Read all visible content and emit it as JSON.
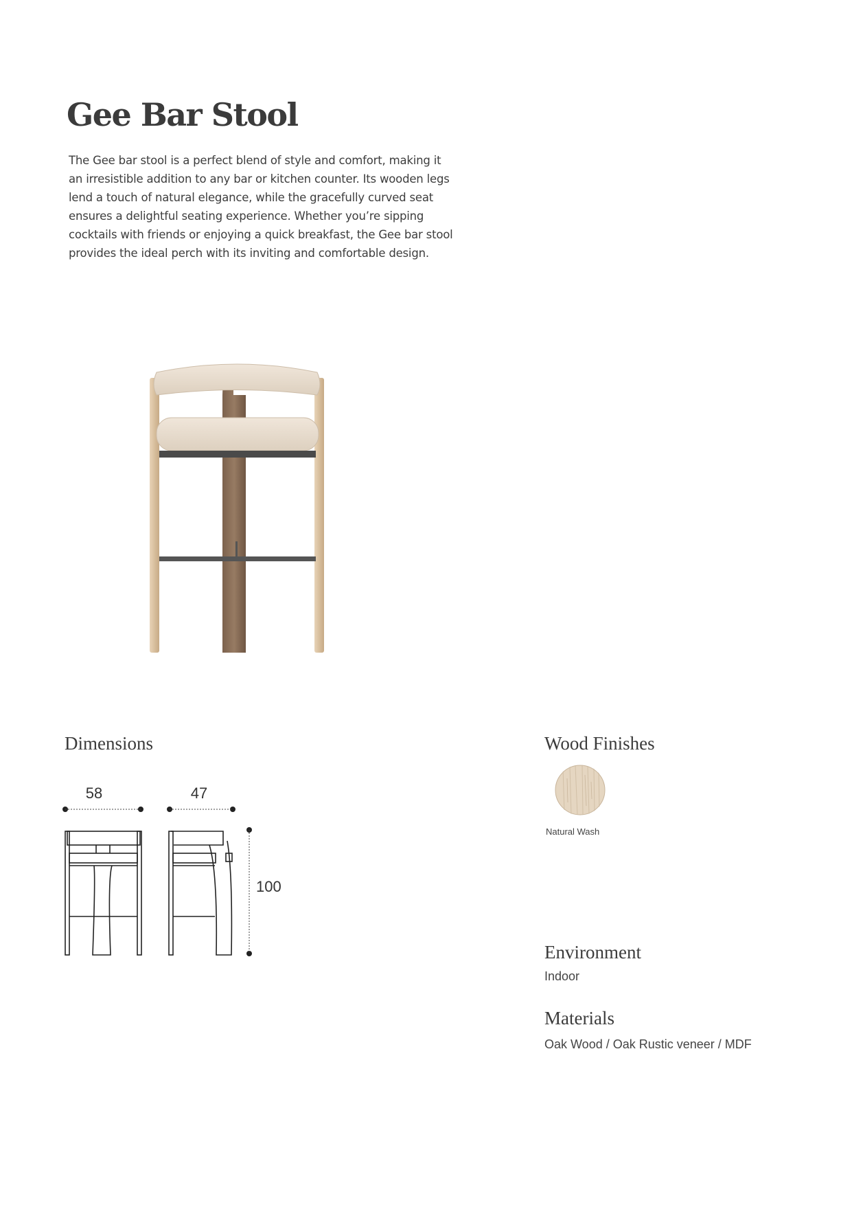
{
  "product": {
    "title": "Gee Bar Stool",
    "description": "The Gee bar stool is a perfect blend of style and comfort, making it an irresistible addition to any bar or kitchen counter. Its wooden legs lend a touch of natural elegance, while the gracefully curved seat ensures a delightful seating experience. Whether you’re sipping cocktails with friends or enjoying a quick breakfast, the Gee bar stool provides the ideal perch with its inviting and comfortable design."
  },
  "dimensions": {
    "heading": "Dimensions",
    "width": "58",
    "depth": "47",
    "height": "100"
  },
  "wood_finishes": {
    "heading": "Wood Finishes",
    "items": [
      {
        "label": "Natural Wash",
        "color": "#e3d3bb"
      }
    ]
  },
  "environment": {
    "heading": "Environment",
    "value": "Indoor"
  },
  "materials": {
    "heading": "Materials",
    "value": "Oak Wood / Oak Rustic veneer / MDF"
  },
  "colors": {
    "upholstery": "#e9ded0",
    "wood_light": "#dcc3a3",
    "wood_dark": "#8f745d",
    "metal": "#4a4a4a",
    "text": "#3b3b3b"
  }
}
